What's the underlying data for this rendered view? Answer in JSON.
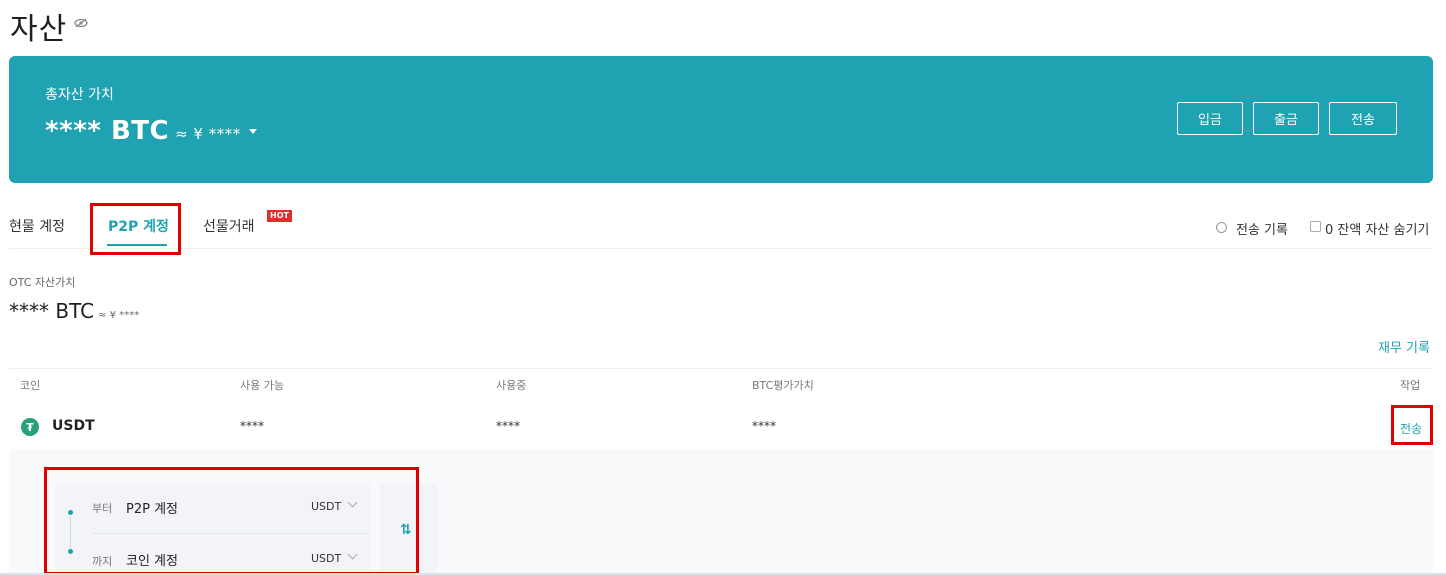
{
  "page": {
    "title": "자산"
  },
  "summary": {
    "label": "총자산 가치",
    "value": "**** BTC",
    "approx": "≈ ¥ ****",
    "buttons": {
      "deposit": "입금",
      "withdraw": "출금",
      "transfer": "전송"
    }
  },
  "tabs": [
    {
      "label": "현물 계정"
    },
    {
      "label": "P2P 계정"
    },
    {
      "label": "선물거래"
    }
  ],
  "hot_badge": "HOT",
  "tools": {
    "transfer_history": "전송 기록",
    "hide_zero": "0 잔액 자산 숨기기"
  },
  "otc": {
    "label": "OTC 자산가치",
    "value": "**** BTC",
    "approx": "≈ ¥ ****"
  },
  "finance_link": "재무 기록",
  "table": {
    "headers": {
      "coin": "코인",
      "available": "사용 가능",
      "in_use": "사용중",
      "btc_value": "BTC평가가치",
      "action": "작업"
    },
    "row": {
      "coin": "USDT",
      "available": "****",
      "in_use": "****",
      "btc_value": "****",
      "action": "전송"
    }
  },
  "transfer": {
    "from_label": "부터",
    "from_value": "P2P 계정",
    "from_coin": "USDT",
    "to_label": "까지",
    "to_value": "코인 계정",
    "to_coin": "USDT"
  },
  "colors": {
    "accent": "#1fa3b3",
    "highlight": "#e00000",
    "tether": "#26a17b",
    "hot": "#e02d2d"
  }
}
